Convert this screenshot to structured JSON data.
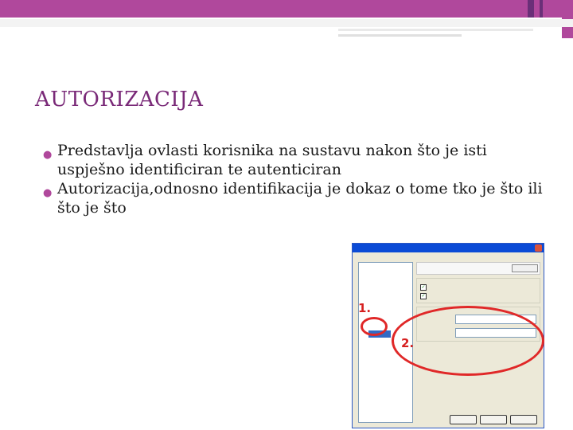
{
  "slide": {
    "title": "AUTORIZACIJA",
    "bullets": [
      "Predstavlja ovlasti korisnika na sustavu nakon što je isti uspješno identificiran te autenticiran",
      "Autorizacija,odnosno identifikacija je dokaz o tome tko je što ili što je što"
    ]
  },
  "colors": {
    "accent": "#b0489c",
    "title": "#7a2a78",
    "annotation": "#e02828"
  },
  "annotations": {
    "mark1": "1.",
    "mark2": "2."
  }
}
